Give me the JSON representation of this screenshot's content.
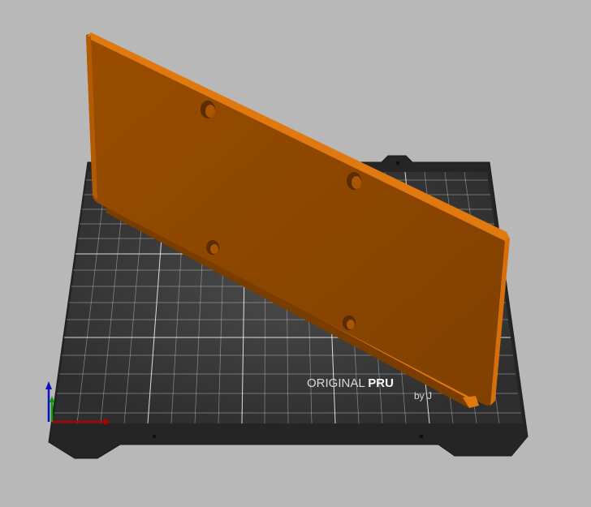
{
  "scene": {
    "background_color": "#b8b8b8",
    "bed": {
      "frame_color": "#2b2b2b",
      "surface_color": "#3a3a3a",
      "grid_color": "#d8d8d8",
      "brand_line1_regular": "ORIGINAL ",
      "brand_line1_bold": "PRU",
      "brand_line2": "by J"
    },
    "model": {
      "color": "#8a4500",
      "edge_color": "#e07a10",
      "hole_count": 4
    },
    "axes": {
      "x_color": "#b00000",
      "y_color": "#00a000",
      "z_color": "#1010c0"
    }
  }
}
